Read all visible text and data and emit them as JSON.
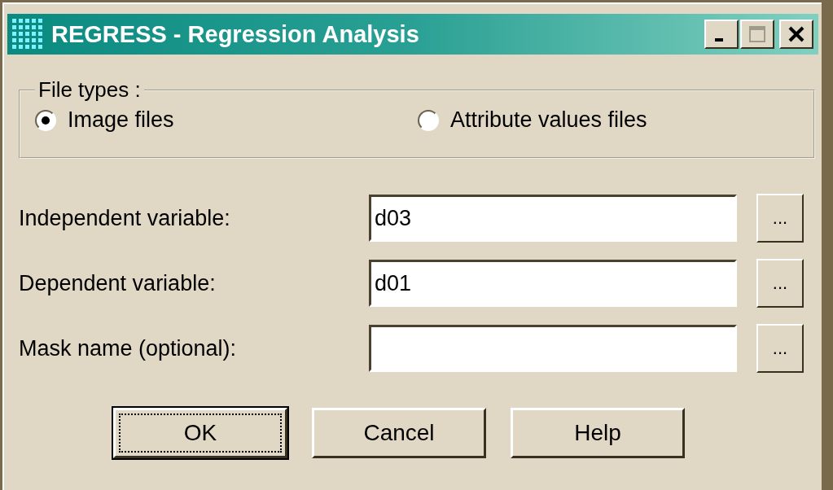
{
  "window": {
    "title": "REGRESS - Regression Analysis",
    "controls": [
      {
        "kind": "minimize"
      },
      {
        "kind": "maximize",
        "disabled": true
      },
      {
        "kind": "close"
      }
    ]
  },
  "file_types": {
    "legend": "File types :",
    "options": [
      {
        "label": "Image files",
        "selected": true
      },
      {
        "label": "Attribute values files",
        "selected": false
      }
    ]
  },
  "fields": [
    {
      "label": "Independent variable:",
      "value": "d03",
      "browse": "..."
    },
    {
      "label": "Dependent variable:",
      "value": "d01",
      "browse": "..."
    },
    {
      "label": "Mask name (optional):",
      "browse": "..."
    }
  ],
  "buttons": [
    {
      "label": "OK",
      "default": true
    },
    {
      "label": "Cancel",
      "default": false
    },
    {
      "label": "Help",
      "default": false
    }
  ]
}
